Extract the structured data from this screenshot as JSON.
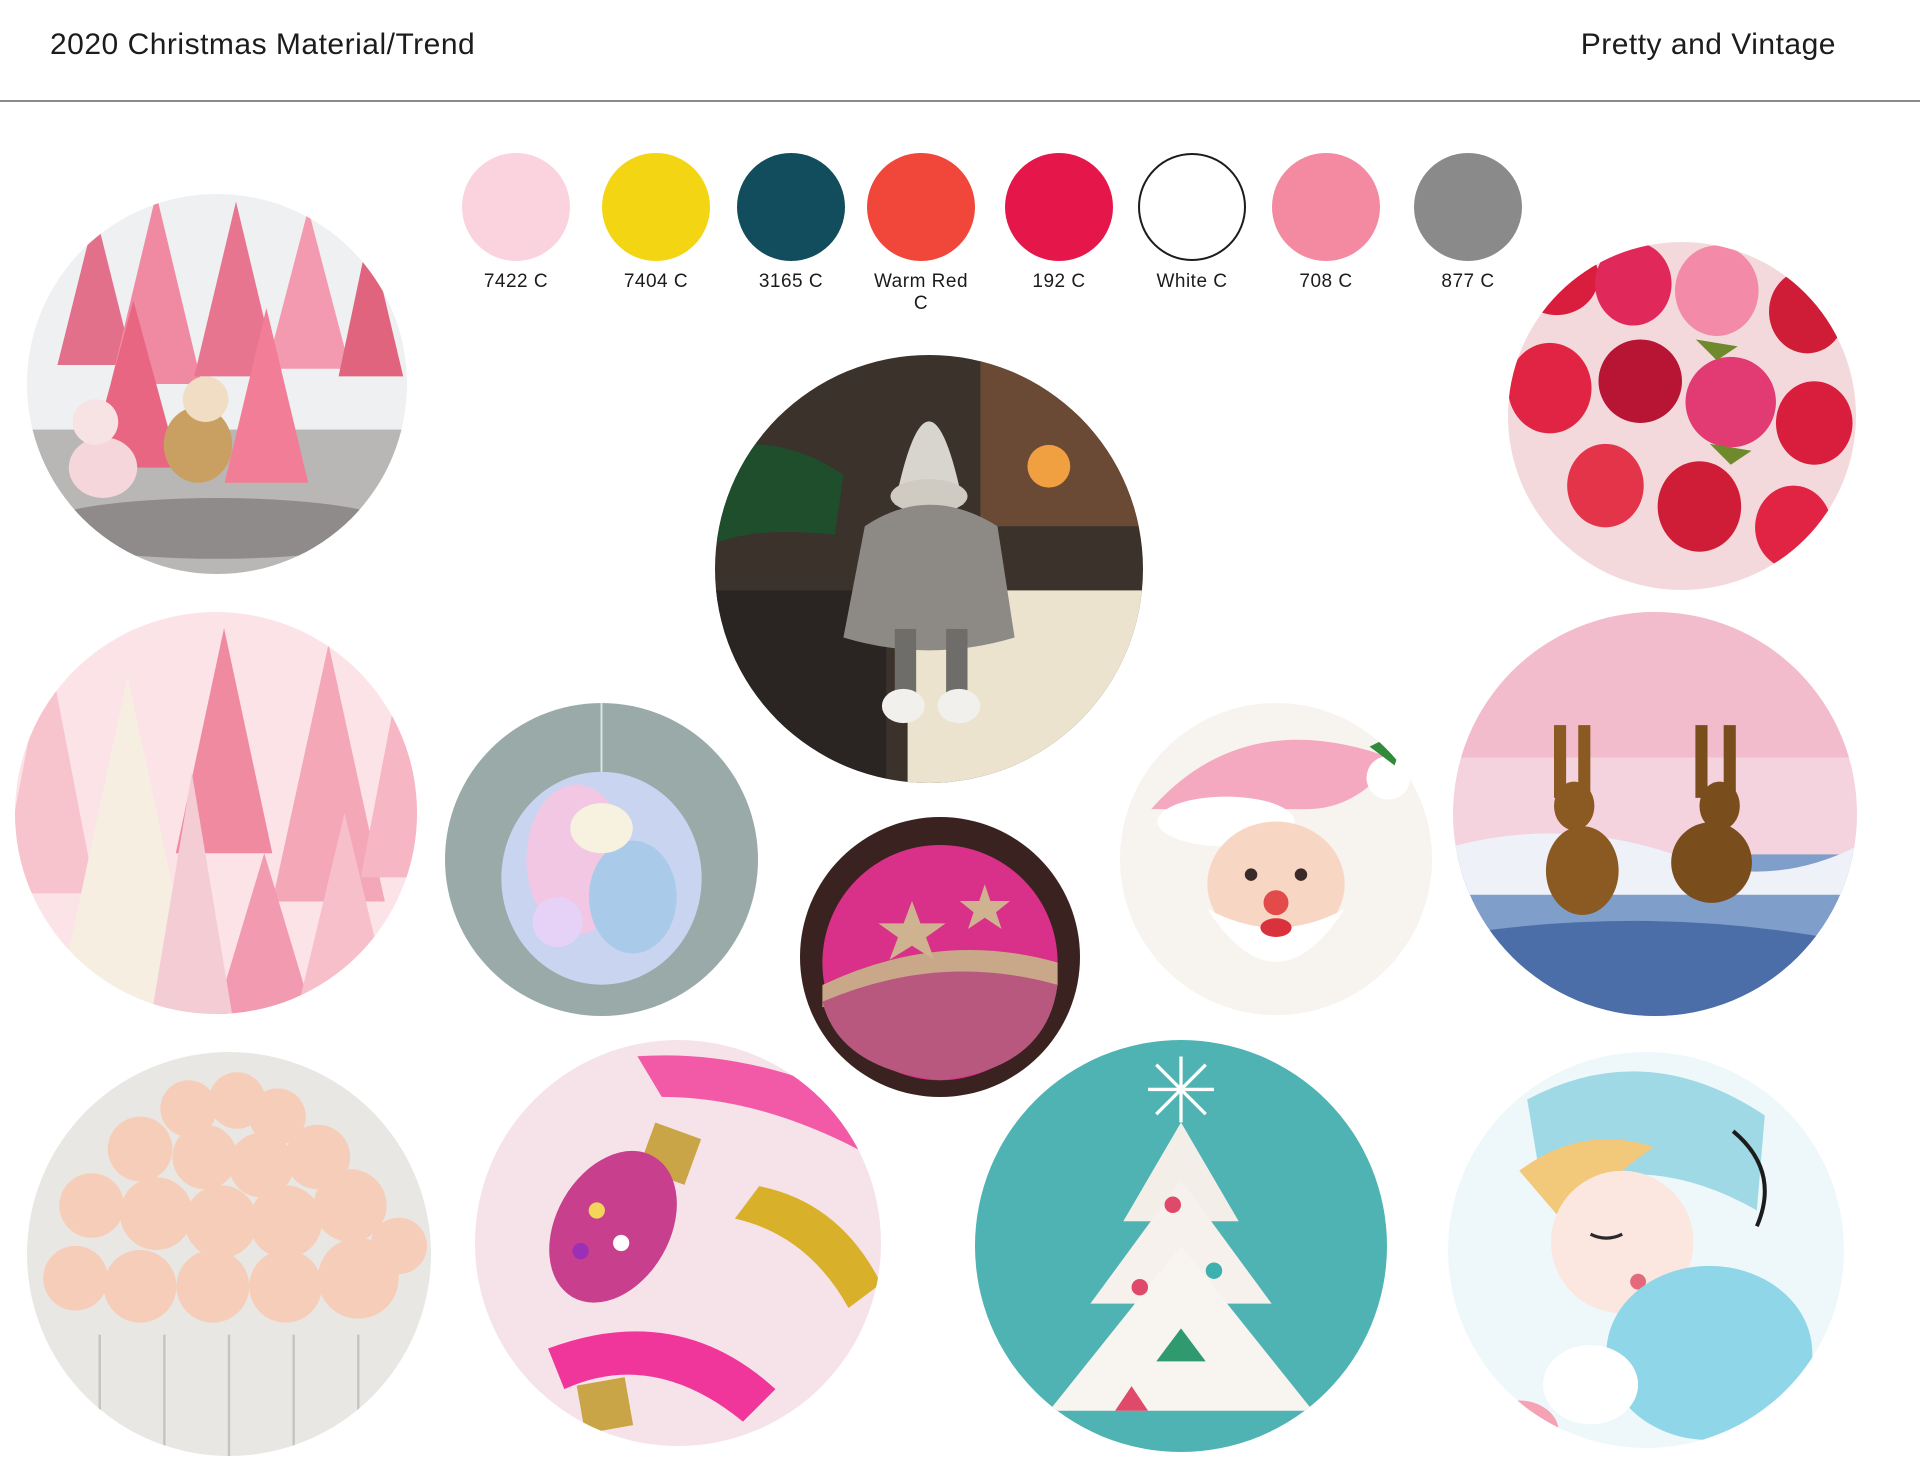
{
  "header": {
    "title": "2020 Christmas Material/Trend",
    "theme": "Pretty and Vintage"
  },
  "palette": [
    {
      "code": "7422 C",
      "color": "#fbd3df"
    },
    {
      "code": "7404 C",
      "color": "#f3d513"
    },
    {
      "code": "3165 C",
      "color": "#114d5c"
    },
    {
      "code": "Warm Red C",
      "color": "#f0473a"
    },
    {
      "code": "192 C",
      "color": "#e5174a"
    },
    {
      "code": "White C",
      "color": "#ffffff"
    },
    {
      "code": "708 C",
      "color": "#f38aa1"
    },
    {
      "code": "877 C",
      "color": "#8a8a8a"
    }
  ],
  "photos": [
    {
      "name": "pink-bottle-brush-trees-with-deer"
    },
    {
      "name": "gnome-figure"
    },
    {
      "name": "red-strawberry-ornaments"
    },
    {
      "name": "pink-and-cream-bottle-brush-trees"
    },
    {
      "name": "iridescent-honeycomb-ornament"
    },
    {
      "name": "pink-glitter-ball-ornament"
    },
    {
      "name": "vintage-pink-santa-card"
    },
    {
      "name": "vintage-bunnies-card"
    },
    {
      "name": "pink-pom-pom-garland"
    },
    {
      "name": "glitter-bulb-ornaments-with-ribbon"
    },
    {
      "name": "vintage-white-christmas-tree-card"
    },
    {
      "name": "vintage-angel-girl-card"
    }
  ]
}
